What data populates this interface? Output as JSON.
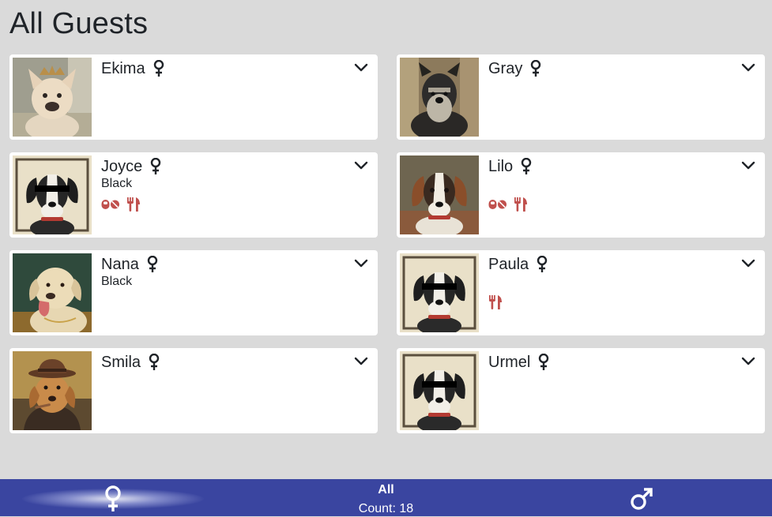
{
  "page": {
    "title": "All Guests"
  },
  "colors": {
    "background": "#dadada",
    "card": "#ffffff",
    "bottom_bar": "#3a45a0",
    "tag_red": "#c0504d"
  },
  "guests": [
    {
      "name": "Ekima",
      "sex_icon": "female-icon",
      "portrait": "french-bulldog-with-tiara-portrait",
      "color": "",
      "tags": []
    },
    {
      "name": "Gray",
      "sex_icon": "female-icon",
      "portrait": "schnauzer-portrait",
      "color": "",
      "tags": []
    },
    {
      "name": "Joyce",
      "sex_icon": "female-icon",
      "portrait": "placeholder-hound-portrait",
      "color": "Black",
      "tags": [
        "medication-icon",
        "food-icon"
      ]
    },
    {
      "name": "Lilo",
      "sex_icon": "female-icon",
      "portrait": "beagle-portrait",
      "color": "",
      "tags": [
        "medication-icon",
        "food-icon"
      ]
    },
    {
      "name": "Nana",
      "sex_icon": "female-icon",
      "portrait": "labrador-portrait",
      "color": "Black",
      "tags": []
    },
    {
      "name": "Paula",
      "sex_icon": "female-icon",
      "portrait": "placeholder-hound-portrait",
      "color": "",
      "tags": [
        "food-icon"
      ]
    },
    {
      "name": "Smila",
      "sex_icon": "female-icon",
      "portrait": "dog-with-hat-and-cigar-portrait",
      "color": "",
      "tags": []
    },
    {
      "name": "Urmel",
      "sex_icon": "female-icon",
      "portrait": "placeholder-hound-portrait",
      "color": "",
      "tags": []
    }
  ],
  "bottom_bar": {
    "filter_label": "All",
    "count_text": "Count: 18",
    "left_icon": "female-icon",
    "right_icon": "male-icon"
  }
}
